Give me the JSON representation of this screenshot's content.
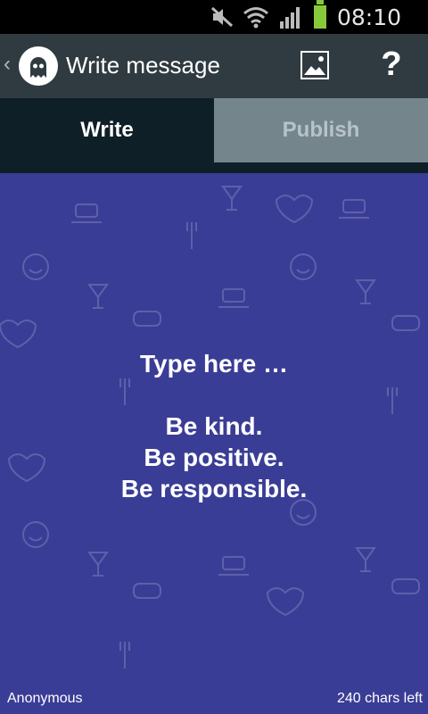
{
  "status_bar": {
    "time": "08:10"
  },
  "app_bar": {
    "title": "Write message",
    "icons": [
      "back-chevron",
      "ghost-logo",
      "image-icon",
      "help-icon"
    ],
    "help_label": "?"
  },
  "tabs": [
    {
      "label": "Write",
      "active": true
    },
    {
      "label": "Publish",
      "active": false
    }
  ],
  "compose": {
    "text": "Type here …\n\nBe kind.\nBe positive.\nBe responsible.",
    "background_color": "#3a3d96"
  },
  "footer": {
    "author": "Anonymous",
    "chars_left": "240 chars left"
  },
  "colors": {
    "app_bar": "#2f3b41",
    "tab_active": "#0f1f27",
    "tab_inactive": "#75858c",
    "battery": "#88c93b"
  }
}
